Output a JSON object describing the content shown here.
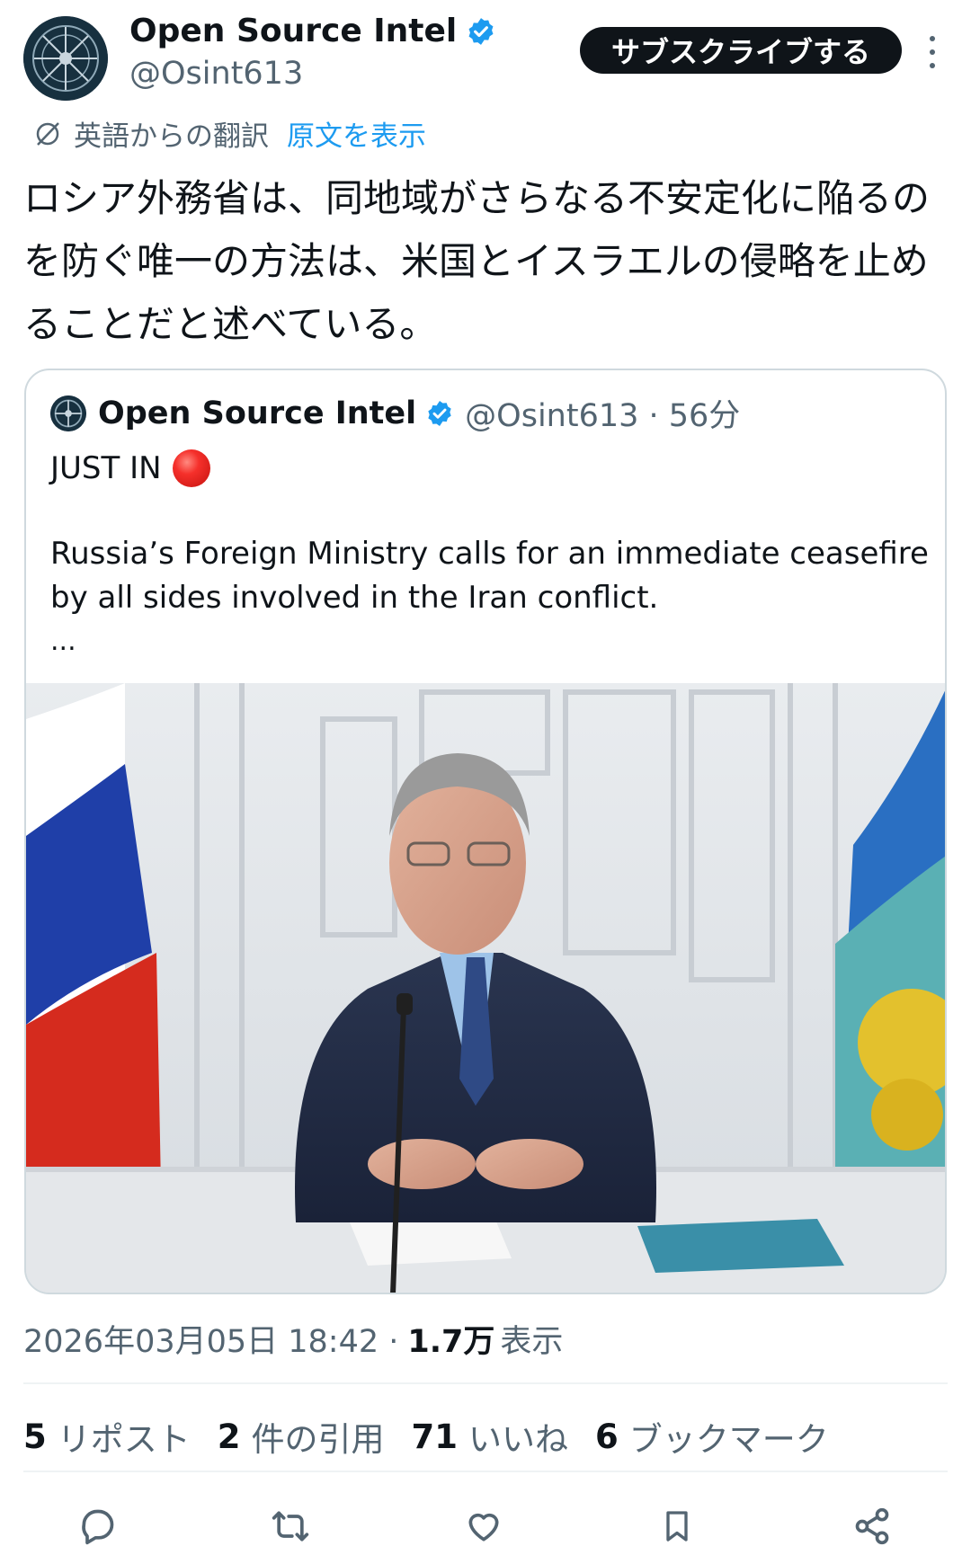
{
  "author": {
    "name": "Open Source Intel",
    "handle": "@Osint613",
    "verified_icon": "verified-badge-icon",
    "avatar_icon": "compass-emblem-avatar"
  },
  "header": {
    "subscribe_label": "サブスクライブする",
    "more_icon": "more-vertical-icon"
  },
  "translation": {
    "icon": "translate-icon",
    "label": "英語からの翻訳",
    "show_original": "原文を表示"
  },
  "post": {
    "text": "ロシア外務省は、同地域がさらなる不安定化に陥るのを防ぐ唯一の方法は、米国とイスラエルの侵略を止めることだと述べている。"
  },
  "quoted": {
    "name": "Open Source Intel",
    "handle": "@Osint613 · 56分",
    "line1": "JUST IN",
    "body": "Russia’s Foreign Ministry calls for an immediate ceasefire by all sides involved in the Iran conflict.",
    "ellipsis": "..."
  },
  "meta": {
    "datetime": "2026年03月05日 18:42 ·",
    "views_count": "1.7万",
    "views_label": "表示"
  },
  "stats": [
    {
      "count": "5",
      "label": "リポスト"
    },
    {
      "count": "2",
      "label": "件の引用"
    },
    {
      "count": "71",
      "label": "いいね"
    },
    {
      "count": "6",
      "label": "ブックマーク"
    }
  ],
  "actions": [
    "reply-icon",
    "repost-icon",
    "like-icon",
    "bookmark-icon",
    "share-icon"
  ],
  "colors": {
    "text": "#0f1419",
    "secondary": "#536471",
    "link": "#1d9bf0",
    "verified": "#1d9bf0",
    "border": "#cfd9de"
  }
}
